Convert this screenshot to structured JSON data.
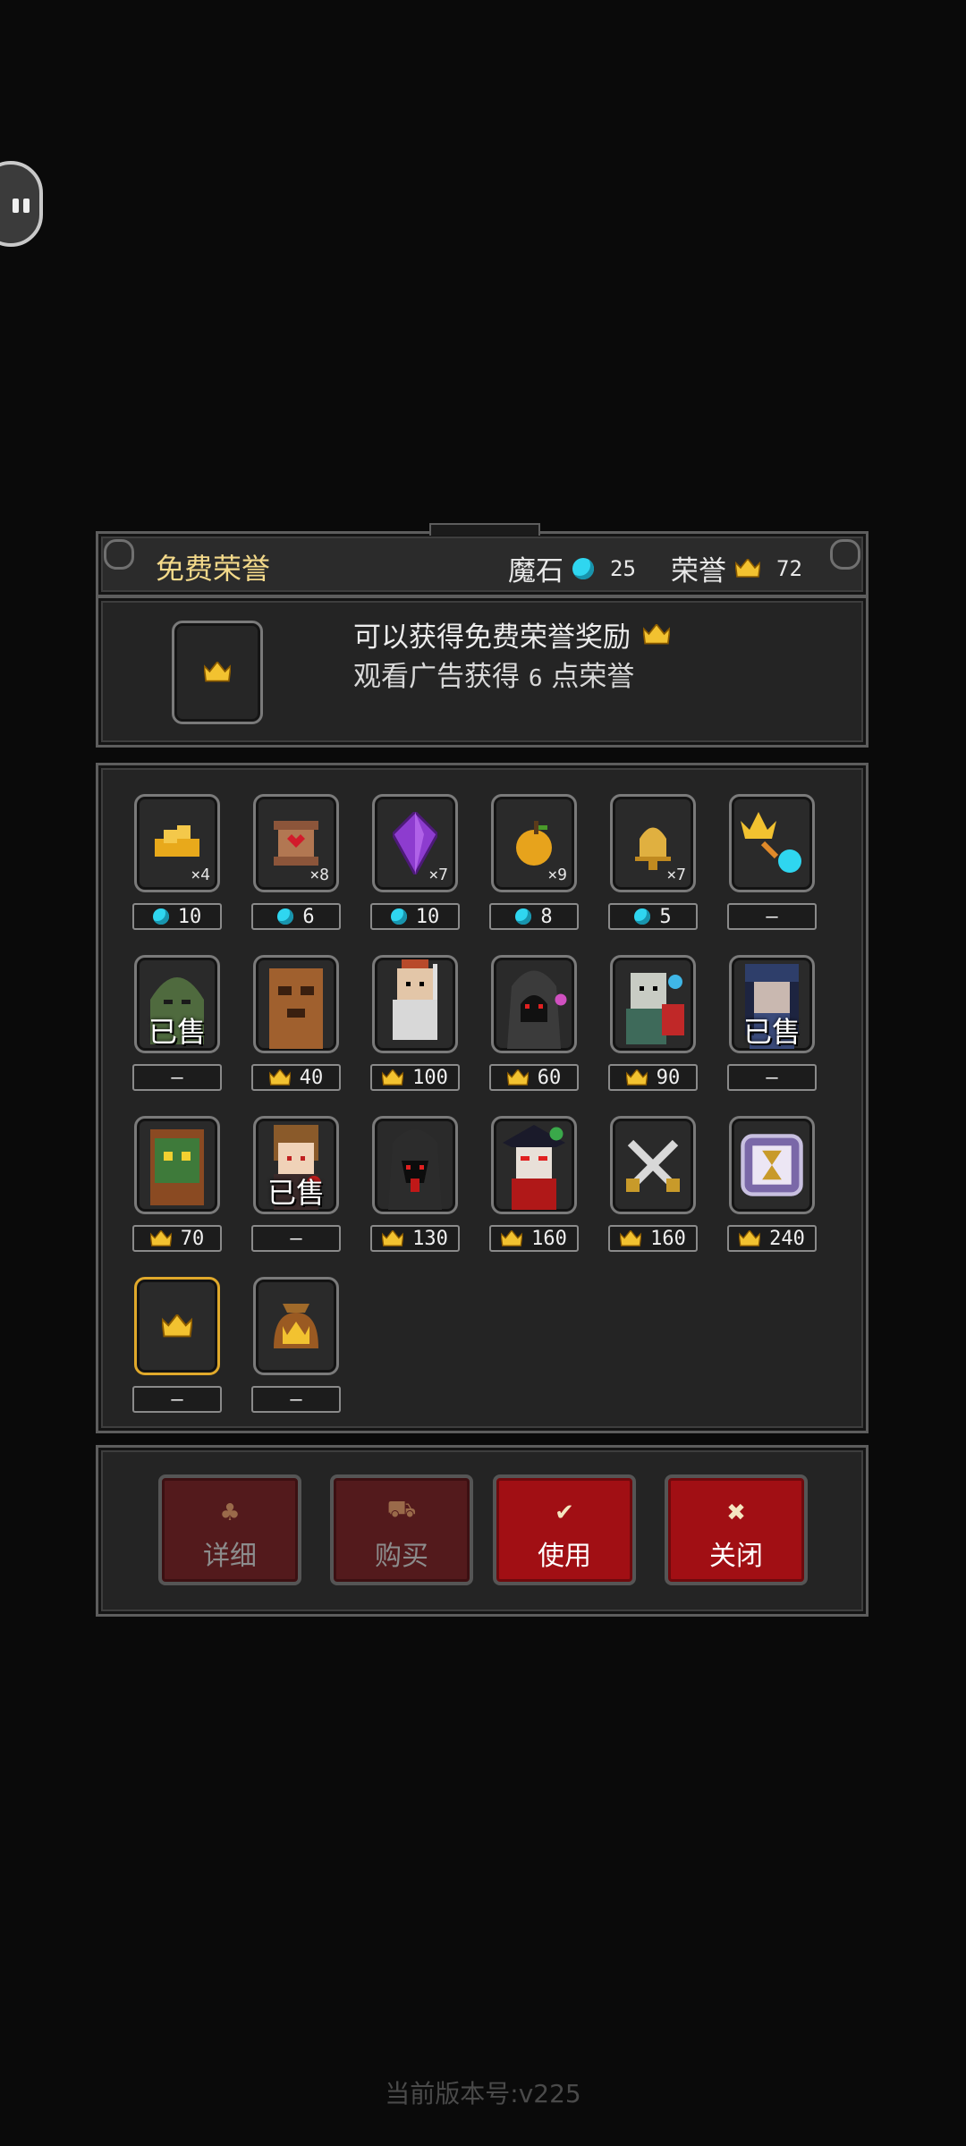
{
  "header": {
    "title": "免费荣誉",
    "magic_stone_label": "魔石",
    "magic_stone_value": "25",
    "honor_label": "荣誉",
    "honor_value": "72"
  },
  "info": {
    "line1": "可以获得免费荣誉奖励",
    "line2_prefix": "观看广告获得",
    "line2_num": "6",
    "line2_suffix": "点荣誉"
  },
  "items": [
    {
      "icon": "golden-hands-icon",
      "count": "×4",
      "price": "10",
      "currency": "gem"
    },
    {
      "icon": "heart-scroll-icon",
      "count": "×8",
      "price": "6",
      "currency": "gem"
    },
    {
      "icon": "purple-crystal-icon",
      "count": "×7",
      "price": "10",
      "currency": "gem"
    },
    {
      "icon": "golden-apple-icon",
      "count": "×9",
      "price": "8",
      "currency": "gem"
    },
    {
      "icon": "golden-bell-icon",
      "count": "×7",
      "price": "5",
      "currency": "gem"
    },
    {
      "icon": "crown-to-gem-icon",
      "count": "",
      "price": "—",
      "currency": "none"
    },
    {
      "icon": "green-slime-portrait-icon",
      "count": "",
      "sold": "已售",
      "price": "—",
      "currency": "none"
    },
    {
      "icon": "tree-ent-portrait-icon",
      "count": "",
      "price": "40",
      "currency": "crown"
    },
    {
      "icon": "armored-knight-portrait-icon",
      "count": "",
      "price": "100",
      "currency": "crown"
    },
    {
      "icon": "hooded-reaper-portrait-icon",
      "count": "",
      "price": "60",
      "currency": "crown"
    },
    {
      "icon": "zombie-shield-portrait-icon",
      "count": "",
      "price": "90",
      "currency": "crown"
    },
    {
      "icon": "blue-mage-portrait-icon",
      "count": "",
      "sold": "已售",
      "price": "—",
      "currency": "none"
    },
    {
      "icon": "tree-spirit-portrait-icon",
      "count": "",
      "price": "70",
      "currency": "crown"
    },
    {
      "icon": "brown-hair-girl-portrait-icon",
      "count": "",
      "sold": "已售",
      "price": "—",
      "currency": "none"
    },
    {
      "icon": "shadow-demon-portrait-icon",
      "count": "",
      "price": "130",
      "currency": "crown"
    },
    {
      "icon": "pirate-captain-portrait-icon",
      "count": "",
      "price": "160",
      "currency": "crown"
    },
    {
      "icon": "crossed-swords-icon",
      "count": "",
      "price": "160",
      "currency": "crown"
    },
    {
      "icon": "hourglass-frame-icon",
      "count": "",
      "price": "240",
      "currency": "crown"
    },
    {
      "icon": "crown-icon",
      "count": "",
      "price": "—",
      "currency": "none",
      "selected": true
    },
    {
      "icon": "crown-money-bag-icon",
      "count": "",
      "price": "—",
      "currency": "none"
    }
  ],
  "buttons": [
    {
      "label": "详细",
      "icon": "flask-icon",
      "glyph": "♣",
      "state": "disabled"
    },
    {
      "label": "购买",
      "icon": "cart-icon",
      "glyph": "⛟",
      "state": "disabled"
    },
    {
      "label": "使用",
      "icon": "check-icon",
      "glyph": "✔",
      "state": "active"
    },
    {
      "label": "关闭",
      "icon": "close-icon",
      "glyph": "✖",
      "state": "active"
    }
  ],
  "footer": {
    "version": "当前版本号:v225"
  },
  "colors": {
    "gem": "#2fd6f0",
    "crown": "#f2c230",
    "title": "#f3d98a",
    "button_active": "#a10f14",
    "button_disabled": "#531a1c"
  }
}
